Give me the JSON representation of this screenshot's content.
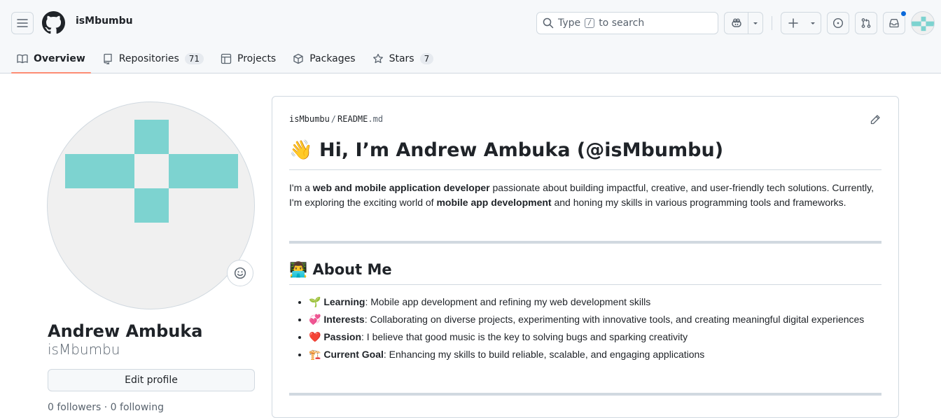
{
  "header": {
    "owner": "isMbumbu",
    "search": {
      "prefix": "Type",
      "key": "/",
      "suffix": "to search"
    }
  },
  "tabs": [
    {
      "label": "Overview",
      "icon": "book-icon",
      "active": true
    },
    {
      "label": "Repositories",
      "icon": "repo-icon",
      "count": "71"
    },
    {
      "label": "Projects",
      "icon": "table-icon"
    },
    {
      "label": "Packages",
      "icon": "package-icon"
    },
    {
      "label": "Stars",
      "icon": "star-icon",
      "count": "7"
    }
  ],
  "profile": {
    "full_name": "Andrew Ambuka",
    "login": "isMbumbu",
    "edit_label": "Edit profile",
    "followers_text": "0 followers · 0 following"
  },
  "readme": {
    "path_owner": "isMbumbu",
    "path_sep": "/",
    "path_file": "README",
    "path_ext": ".md",
    "title": "👋 Hi, I’m Andrew Ambuka (@isMbumbu)",
    "intro": {
      "p1": "I'm a ",
      "b1": "web and mobile application developer",
      "p2": " passionate about building impactful, creative, and user-friendly tech solutions. Currently, I'm exploring the exciting world of ",
      "b2": "mobile app development",
      "p3": " and honing my skills in various programming tools and frameworks."
    },
    "about_heading": "👨‍💻 About Me",
    "about_items": [
      {
        "emoji": "🌱",
        "label": "Learning",
        "text": ": Mobile app development and refining my web development skills"
      },
      {
        "emoji": "💞",
        "label": "Interests",
        "text": ": Collaborating on diverse projects, experimenting with innovative tools, and creating meaningful digital experiences"
      },
      {
        "emoji": "❤️",
        "label": "Passion",
        "text": ": I believe that good music is the key to solving bugs and sparking creativity"
      },
      {
        "emoji": "🏗️",
        "label": "Current Goal",
        "text": ": Enhancing my skills to build reliable, scalable, and engaging applications"
      }
    ]
  },
  "colors": {
    "identicon": "#7dd3d0",
    "tab_underline": "#fd8c73",
    "notification_dot": "#0969da"
  }
}
